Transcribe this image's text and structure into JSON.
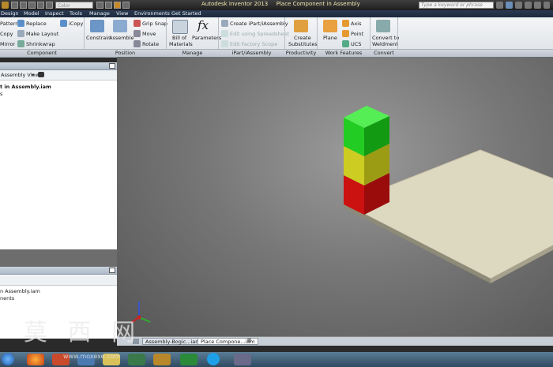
{
  "title_bar": {
    "app_title": "Autodesk Inventor 2013",
    "doc_title": "Place Component in Assembly",
    "color_box": "Color",
    "search_placeholder": "Type a keyword or phrase"
  },
  "menu_tabs": [
    "Design",
    "Model",
    "Inspect",
    "Tools",
    "Manage",
    "View",
    "Environments",
    "Get Started"
  ],
  "ribbon": {
    "component": {
      "pattern": "Pattern",
      "copy": "Copy",
      "mirror": "Mirror",
      "replace": "Replace",
      "make_layout": "Make Layout",
      "shrinkwrap": "Shrinkwrap",
      "icopy": "iCopy"
    },
    "position": {
      "constrain": "Constrain",
      "assemble": "Assemble",
      "grip_snap": "Grip Snap",
      "move": "Move",
      "rotate": "Rotate"
    },
    "manage": {
      "bill_line1": "Bill of",
      "bill_line2": "Materials",
      "parameters": "Parameters",
      "fx": "fx"
    },
    "ipart": {
      "create": "Create iPart/iAssembly",
      "edit_spreadsheet": "Edit using Spreadsheet",
      "edit_factory": "Edit Factory Scope"
    },
    "productivity": {
      "line1": "Create",
      "line2": "Substitutes"
    },
    "work_features": {
      "plane": "Plane",
      "axis": "Axis",
      "point": "Point",
      "ucs": "UCS"
    },
    "convert": {
      "line1": "Convert to",
      "line2": "Weldment"
    },
    "groups": {
      "component": "Component",
      "position": "Position",
      "manage": "Manage",
      "ipart": "iPart/iAssembly",
      "productivity": "Productivity",
      "work_features": "Work Features",
      "convert": "Convert"
    }
  },
  "browser": {
    "view_label": "Assembly View",
    "tree_root": "t in Assembly.iam",
    "tree_child": "s",
    "lower_item1": "n Assembly.iam",
    "lower_item2": "nents"
  },
  "doc_tabs": [
    "Assembly-Bogic...iam",
    "Place Compone...iam"
  ],
  "watermark": "莫 西 网",
  "watermark_url": "www.moxexe.com",
  "colors": {
    "green": "#22cc22",
    "yellow": "#cccc22",
    "red": "#cc1111",
    "plate": "#ddd8c0"
  }
}
